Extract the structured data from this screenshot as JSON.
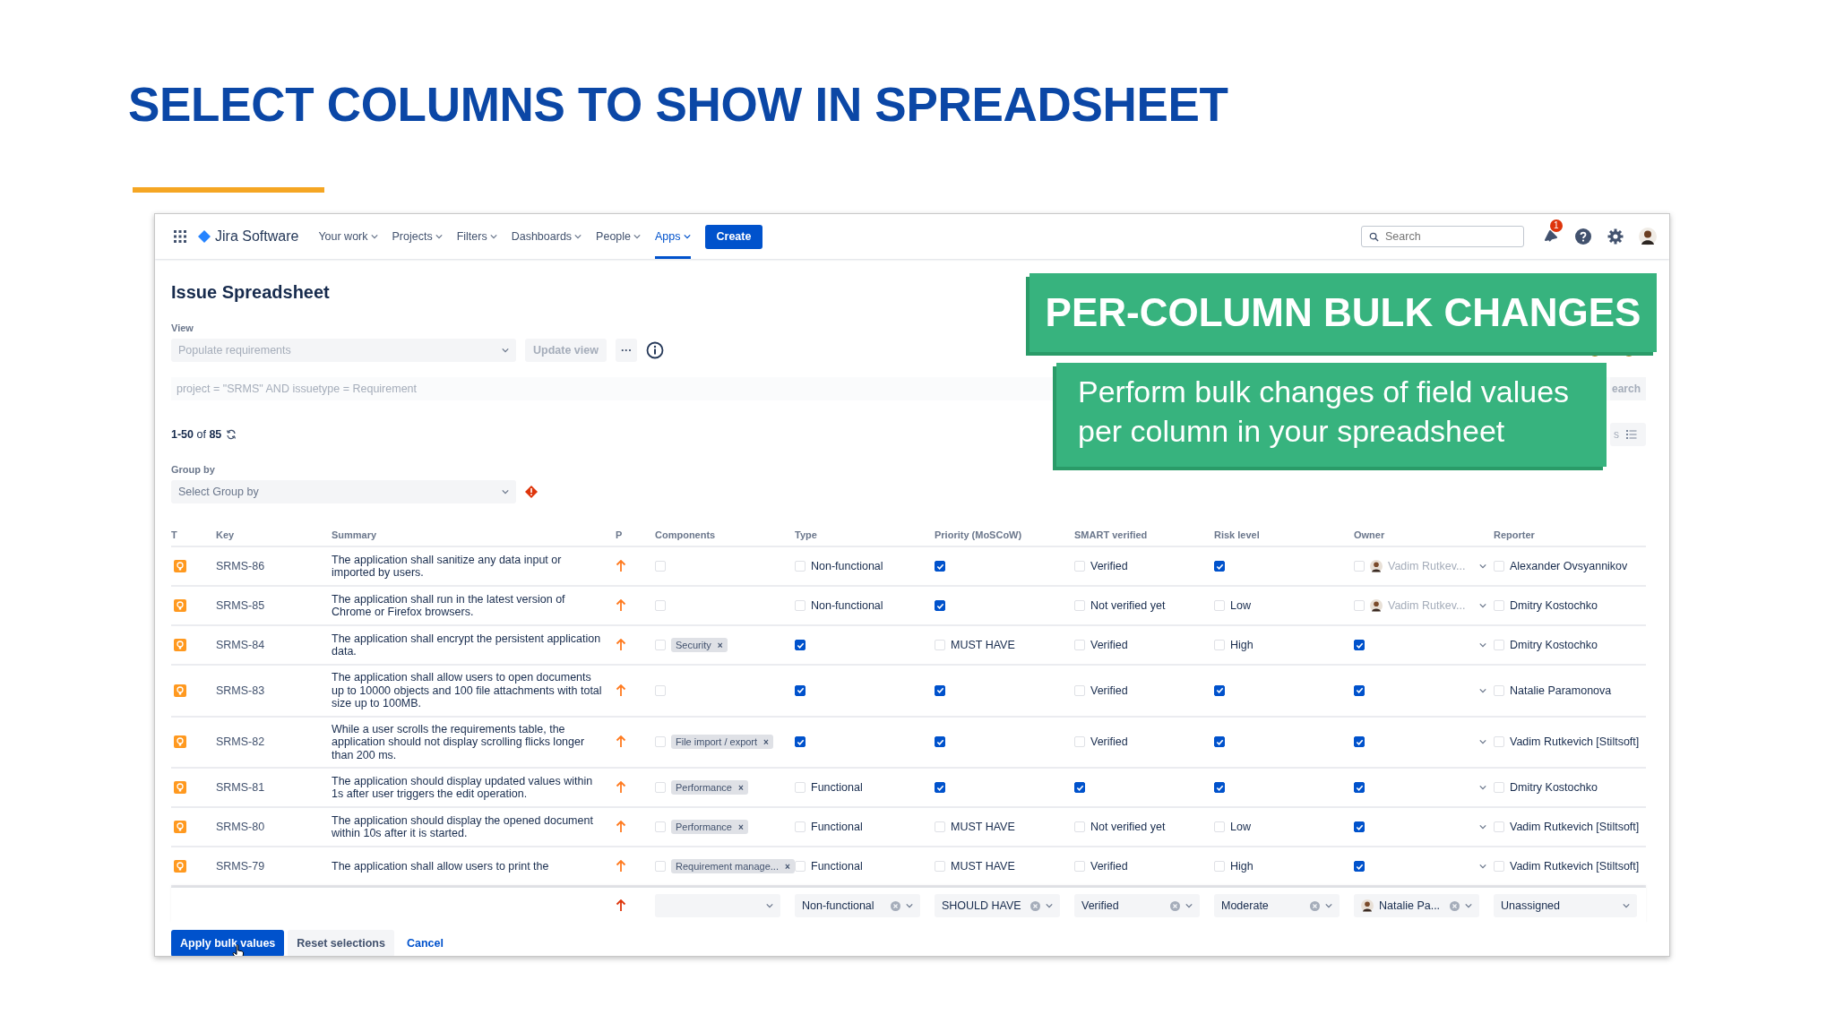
{
  "slide": {
    "title": "SELECT COLUMNS TO SHOW IN SPREADSHEET"
  },
  "nav": {
    "logo": "Jira Software",
    "items": [
      {
        "label": "Your work",
        "selected": false
      },
      {
        "label": "Projects",
        "selected": false
      },
      {
        "label": "Filters",
        "selected": false
      },
      {
        "label": "Dashboards",
        "selected": false
      },
      {
        "label": "People",
        "selected": false
      },
      {
        "label": "Apps",
        "selected": true
      }
    ],
    "create": "Create",
    "search": {
      "placeholder": "Search"
    },
    "badge": "1"
  },
  "page": {
    "title": "Issue Spreadsheet",
    "view_label": "View",
    "view_select": {
      "placeholder": "Populate requirements"
    },
    "update_button": "Update view",
    "more_button": "···",
    "query": {
      "placeholder": "project = \"SRMS\" AND issuetype = Requirement"
    },
    "query_button": "earch",
    "count": "**1-50** of **85**",
    "columns_button": "s",
    "group_label": "Group by",
    "group_select": {
      "placeholder": "Select Group by"
    }
  },
  "table": {
    "columns": [
      "T",
      "Key",
      "Summary",
      "P",
      "Components",
      "Type",
      "Priority (MoSCoW)",
      "SMART verified",
      "Risk level",
      "Owner",
      "Reporter"
    ],
    "rows": [
      {
        "key": "SRMS-86",
        "summary": "The application shall sanitize any data input or imported by users.",
        "components": {
          "checked": false
        },
        "type": {
          "checked": false,
          "value": "Non-functional"
        },
        "moscow": {
          "checked": true
        },
        "smart": {
          "checked": false,
          "value": "Verified"
        },
        "risk": {
          "checked": true
        },
        "owner": {
          "checked": false,
          "value": "Vadim Rutkev..."
        },
        "reporter": {
          "checked": false,
          "value": "Alexander Ovsyannikov"
        }
      },
      {
        "key": "SRMS-85",
        "summary": "The application shall run in the latest version of Chrome or Firefox browsers.",
        "components": {
          "checked": false
        },
        "type": {
          "checked": false,
          "value": "Non-functional"
        },
        "moscow": {
          "checked": true
        },
        "smart": {
          "checked": false,
          "value": "Not verified yet"
        },
        "risk": {
          "checked": false,
          "value": "Low"
        },
        "owner": {
          "checked": false,
          "value": "Vadim Rutkev..."
        },
        "reporter": {
          "checked": false,
          "value": "Dmitry Kostochko"
        }
      },
      {
        "key": "SRMS-84",
        "summary": "The application shall encrypt the persistent application data.",
        "components": {
          "checked": false,
          "chips": [
            {
              "label": "Security",
              "remove": "×"
            }
          ]
        },
        "type": {
          "checked": true
        },
        "moscow": {
          "checked": false,
          "value": "MUST HAVE"
        },
        "smart": {
          "checked": false,
          "value": "Verified"
        },
        "risk": {
          "checked": false,
          "value": "High"
        },
        "owner": {
          "checked": true
        },
        "reporter": {
          "checked": false,
          "value": "Dmitry Kostochko"
        }
      },
      {
        "key": "SRMS-83",
        "summary": "The application shall allow users to open documents up to 10000 objects and 100 file attachments with total size up to 100MB.",
        "components": {
          "checked": false
        },
        "type": {
          "checked": true
        },
        "moscow": {
          "checked": true
        },
        "smart": {
          "checked": false,
          "value": "Verified"
        },
        "risk": {
          "checked": true
        },
        "owner": {
          "checked": true
        },
        "reporter": {
          "checked": false,
          "value": "Natalie Paramonova"
        }
      },
      {
        "key": "SRMS-82",
        "summary": "While a user scrolls the requirements table, the application should not display scrolling flicks longer than 200 ms.",
        "components": {
          "checked": false,
          "chips": [
            {
              "label": "File import / export",
              "remove": "×"
            }
          ]
        },
        "type": {
          "checked": true
        },
        "moscow": {
          "checked": true
        },
        "smart": {
          "checked": false,
          "value": "Verified"
        },
        "risk": {
          "checked": true
        },
        "owner": {
          "checked": true
        },
        "reporter": {
          "checked": false,
          "value": "Vadim Rutkevich [Stiltsoft]"
        }
      },
      {
        "key": "SRMS-81",
        "summary": "The application should display updated values within 1s after user triggers the edit operation.",
        "components": {
          "checked": false,
          "chips": [
            {
              "label": "Performance",
              "remove": "×"
            }
          ]
        },
        "type": {
          "checked": false,
          "value": "Functional"
        },
        "moscow": {
          "checked": true
        },
        "smart": {
          "checked": true
        },
        "risk": {
          "checked": true
        },
        "owner": {
          "checked": true
        },
        "reporter": {
          "checked": false,
          "value": "Dmitry Kostochko"
        }
      },
      {
        "key": "SRMS-80",
        "summary": "The application should display the opened document within 10s after it is started.",
        "components": {
          "checked": false,
          "chips": [
            {
              "label": "Performance",
              "remove": "×"
            }
          ]
        },
        "type": {
          "checked": false,
          "value": "Functional"
        },
        "moscow": {
          "checked": false,
          "value": "MUST HAVE"
        },
        "smart": {
          "checked": false,
          "value": "Not verified yet"
        },
        "risk": {
          "checked": false,
          "value": "Low"
        },
        "owner": {
          "checked": true
        },
        "reporter": {
          "checked": false,
          "value": "Vadim Rutkevich [Stiltsoft]"
        }
      },
      {
        "key": "SRMS-79",
        "summary": "The application shall allow users to print the",
        "components": {
          "checked": false,
          "chips": [
            {
              "label": "Requirement manage...",
              "remove": "×"
            }
          ]
        },
        "type": {
          "checked": false,
          "value": "Functional"
        },
        "moscow": {
          "checked": false,
          "value": "MUST HAVE"
        },
        "smart": {
          "checked": false,
          "value": "Verified"
        },
        "risk": {
          "checked": false,
          "value": "High"
        },
        "owner": {
          "checked": true
        },
        "reporter": {
          "checked": false,
          "value": "Vadim Rutkevich [Stiltsoft]"
        }
      }
    ],
    "bulk": [
      {
        "clearable": false
      },
      {
        "value": "Non-functional",
        "clearable": true
      },
      {
        "value": "SHOULD HAVE",
        "clearable": true
      },
      {
        "value": "Verified",
        "clearable": true
      },
      {
        "value": "Moderate",
        "clearable": true
      },
      {
        "value": "Natalie Pa...",
        "clearable": true,
        "avatar": true
      },
      {
        "value": "Unassigned",
        "clearable": false
      }
    ]
  },
  "actions": {
    "apply": "Apply bulk values",
    "reset": "Reset selections",
    "cancel": "Cancel"
  },
  "banner": {
    "heading": "PER-COLUMN BULK CHANGES",
    "text": "Perform bulk changes of field values per column in your spreadsheet"
  }
}
